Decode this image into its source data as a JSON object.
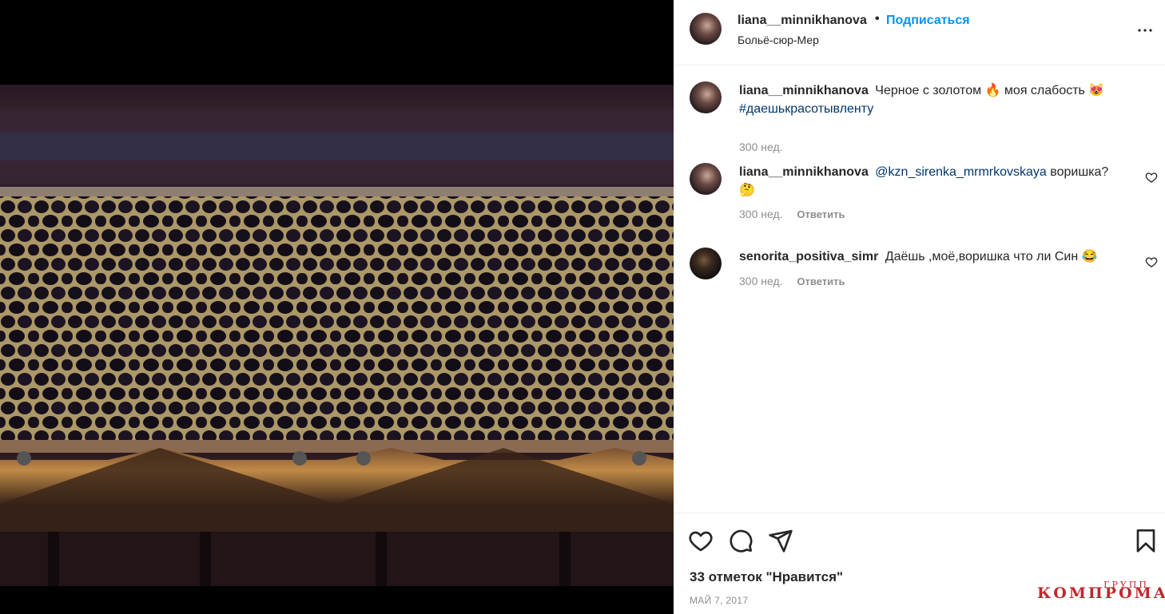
{
  "header": {
    "username": "liana__minnikhanova",
    "separator": "•",
    "follow_label": "Подписаться",
    "location": "Больё-сюр-Мер"
  },
  "comments": [
    {
      "username": "liana__minnikhanova",
      "text_before_emoji1": "Черное с золотом",
      "emoji1": "🔥",
      "text_between": "моя слабость",
      "emoji2": "😻",
      "hashtag": "#даешькрасотывленту",
      "time": "300 нед."
    },
    {
      "username": "liana__minnikhanova",
      "mention": "@kzn_sirenka_mrmrkovskaya",
      "text": "воришка?",
      "emoji": "🤔",
      "time": "300 нед.",
      "reply_label": "Ответить"
    },
    {
      "username": "senorita_positiva_simr",
      "text": "Даёшь ,моё,воришка что ли Син",
      "emoji": "😂",
      "time": "300 нед.",
      "reply_label": "Ответить"
    }
  ],
  "actions": {
    "icons": [
      "heart-icon",
      "comment-icon",
      "share-icon",
      "bookmark-icon"
    ],
    "likes_text": "33 отметок \"Нравится\"",
    "date": "МАЙ 7, 2017"
  },
  "watermark": {
    "top": "ГРУПП",
    "main": "КОМПРОМАТ"
  },
  "colors": {
    "link": "#00376b",
    "follow": "#0095f6",
    "muted": "#8e8e8e",
    "watermark": "#c0272d"
  }
}
